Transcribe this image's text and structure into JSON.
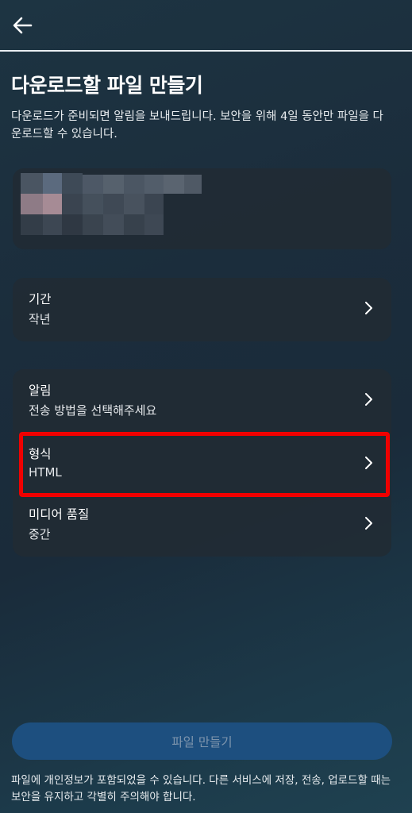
{
  "header": {
    "back_icon": "arrow-left-icon"
  },
  "title": "다운로드할 파일 만들기",
  "description": "다운로드가 준비되면 알림을 보내드립니다. 보안을 위해 4일 동안만 파일을 다운로드할 수 있습니다.",
  "period": {
    "label": "기간",
    "value": "작년"
  },
  "settings": [
    {
      "label": "알림",
      "value": "전송 방법을 선택해주세요"
    },
    {
      "label": "형식",
      "value": "HTML"
    },
    {
      "label": "미디어 품질",
      "value": "중간"
    }
  ],
  "create_button": "파일 만들기",
  "footer_note": "파일에 개인정보가 포함되었을 수 있습니다. 다른 서비스에 저장, 전송, 업로드할 때는 보안을 유지하고 각별히 주의해야 합니다.",
  "colors": {
    "highlight": "#f00000",
    "button_bg": "#1d4f7f",
    "button_text": "#7e95ad"
  }
}
